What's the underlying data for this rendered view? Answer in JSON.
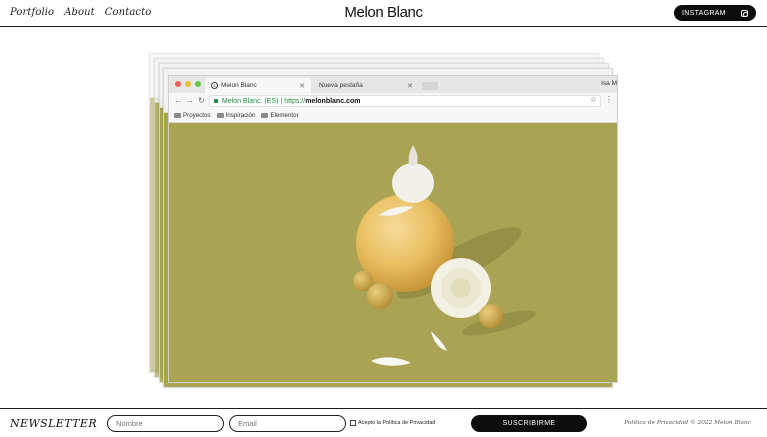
{
  "nav": {
    "portfolio": "Portfolio",
    "about": "About",
    "contact": "Contacto"
  },
  "brand": "Melon Blanc",
  "instagram_button": "INSTAGRAM",
  "browser": {
    "tab_active": "Melon Blanc",
    "tab_inactive": "Nueva pestaña",
    "profile": "Isa M",
    "address_secure": "Melon Blanc. (ES) |",
    "address_scheme": "https://",
    "address_domain": "melonblanc.com",
    "bookmarks": [
      "Proyectos",
      "Inspiración",
      "Elementor"
    ]
  },
  "footer": {
    "newsletter": "NEWSLETTER",
    "name_placeholder": "Nombre",
    "email_placeholder": "Email",
    "consent": "Acepto la Política de Privacidad",
    "subscribe": "SUSCRIBIRME",
    "legal": "Política de Privacidad © 2022 Melon Blanc"
  },
  "colors": {
    "accent": "#0d0d0d",
    "photo_bg": "#aaa354"
  }
}
